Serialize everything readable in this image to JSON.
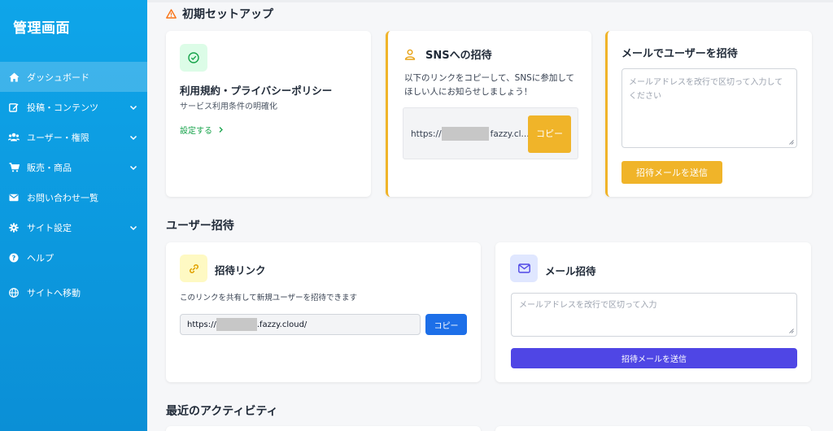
{
  "sidebar": {
    "title": "管理画面",
    "items": [
      {
        "label": "ダッシュボード"
      },
      {
        "label": "投稿・コンテンツ"
      },
      {
        "label": "ユーザー・権限"
      },
      {
        "label": "販売・商品"
      },
      {
        "label": "お問い合わせ一覧"
      },
      {
        "label": "サイト設定"
      },
      {
        "label": "ヘルプ"
      },
      {
        "label": "サイトへ移動"
      }
    ]
  },
  "setup": {
    "heading": "初期セットアップ",
    "terms": {
      "title": "利用規約・プライバシーポリシー",
      "desc": "サービス利用条件の明確化",
      "link": "設定する"
    },
    "sns": {
      "title": "SNSへの招待",
      "desc": "以下のリンクをコピーして、SNSに参加してほしい人にお知らせしましょう！",
      "url_prefix": "https://",
      "url_suffix": "fazzy.cl...",
      "copy_label": "コピー"
    },
    "mail": {
      "title": "メールでユーザーを招待",
      "placeholder": "メールアドレスを改行で区切って入力してください",
      "send_label": "招待メールを送信"
    }
  },
  "invite": {
    "heading": "ユーザー招待",
    "link_card": {
      "title": "招待リンク",
      "desc": "このリンクを共有して新規ユーザーを招待できます",
      "url_prefix": "https://",
      "url_suffix": ".fazzy.cloud/",
      "copy_label": "コピー"
    },
    "mail_card": {
      "title": "メール招待",
      "placeholder": "メールアドレスを改行で区切って入力",
      "send_label": "招待メールを送信"
    }
  },
  "activity": {
    "heading": "最近のアクティビティ"
  },
  "colors": {
    "sidebar": "#0ea5e9",
    "accent_yellow": "#f0b429",
    "primary_blue": "#1d6fe8",
    "indigo": "#4f46e5",
    "green": "#16a34a"
  }
}
